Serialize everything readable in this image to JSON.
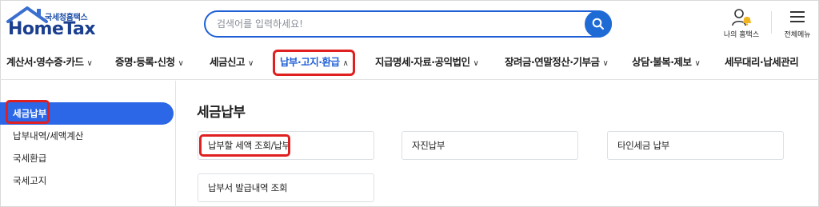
{
  "header": {
    "logo_sub": "국세청홈택스",
    "logo_main": "HomeTax",
    "search_placeholder": "검색어를 입력하세요!",
    "my_hometax_label": "나의 홈택스",
    "all_menu_label": "전체메뉴"
  },
  "nav": {
    "items": [
      {
        "label": "계산서·영수증·카드",
        "chev": "∨"
      },
      {
        "label": "증명·등록·신청",
        "chev": "∨"
      },
      {
        "label": "세금신고",
        "chev": "∨"
      },
      {
        "label": "납부·고지·환급",
        "chev": "∧",
        "active": true
      },
      {
        "label": "지급명세·자료·공익법인",
        "chev": "∨"
      },
      {
        "label": "장려금·연말정산·기부금",
        "chev": "∨"
      },
      {
        "label": "상담·불복·제보",
        "chev": "∨"
      },
      {
        "label": "세무대리·납세관리",
        "chev": "∨"
      }
    ]
  },
  "sidebar": {
    "items": [
      {
        "label": "세금납부",
        "active": true
      },
      {
        "label": "납부내역/세액계산"
      },
      {
        "label": "국세환급"
      },
      {
        "label": "국세고지"
      }
    ]
  },
  "main": {
    "title": "세금납부",
    "cards": [
      {
        "label": "납부할 세액 조회/납부"
      },
      {
        "label": "자진납부"
      },
      {
        "label": "타인세금 납부"
      },
      {
        "label": "납부서 발급내역 조회"
      }
    ]
  },
  "colors": {
    "accent": "#1f5fd6",
    "highlight": "#e02020",
    "sidebar_active": "#2b67e6"
  }
}
